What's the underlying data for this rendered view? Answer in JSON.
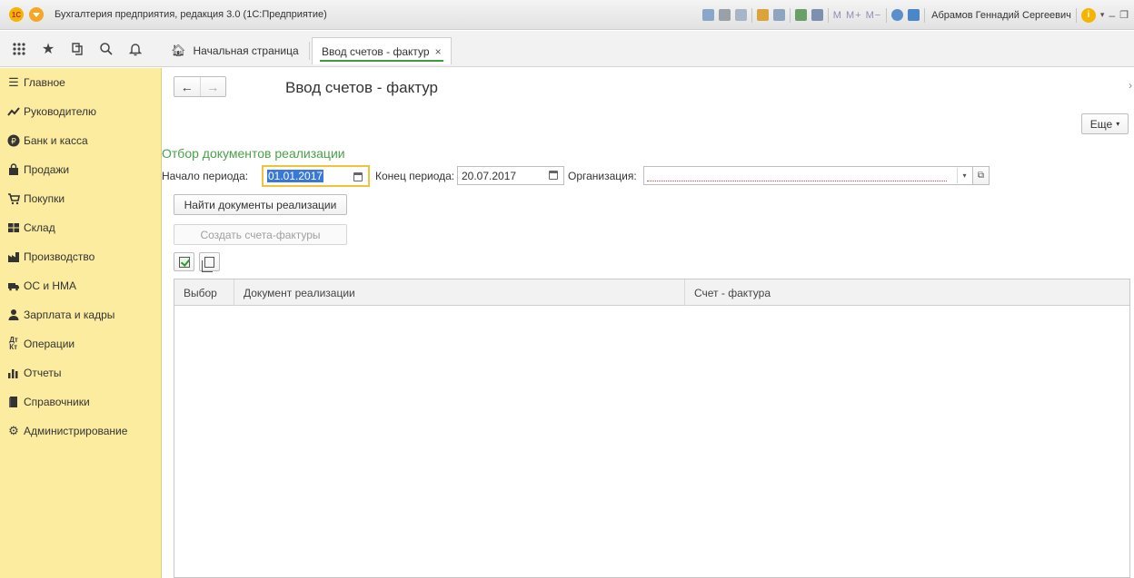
{
  "titlebar": {
    "logo_text": "1С",
    "title": "Бухгалтерия предприятия, редакция 3.0  (1С:Предприятие)",
    "memory_buttons": "M  M+  M−",
    "user": "Абрамов Геннадий Сергеевич",
    "info": "i"
  },
  "tabs": {
    "home": "Начальная страница",
    "active": "Ввод счетов - фактур",
    "close": "×"
  },
  "sidebar": {
    "items": [
      {
        "label": "Главное",
        "icon": "menu-icon"
      },
      {
        "label": "Руководителю",
        "icon": "chart-line-icon"
      },
      {
        "label": "Банк и касса",
        "icon": "ruble-coin-icon"
      },
      {
        "label": "Продажи",
        "icon": "shopping-bag-icon"
      },
      {
        "label": "Покупки",
        "icon": "cart-icon"
      },
      {
        "label": "Склад",
        "icon": "warehouse-icon"
      },
      {
        "label": "Производство",
        "icon": "factory-icon"
      },
      {
        "label": "ОС и НМА",
        "icon": "truck-icon"
      },
      {
        "label": "Зарплата и кадры",
        "icon": "person-icon"
      },
      {
        "label": "Операции",
        "icon": "dt-kt-icon"
      },
      {
        "label": "Отчеты",
        "icon": "bar-chart-icon"
      },
      {
        "label": "Справочники",
        "icon": "book-icon"
      },
      {
        "label": "Администрирование",
        "icon": "gear-icon"
      }
    ]
  },
  "main": {
    "back": "←",
    "forward": "→",
    "title": "Ввод счетов - фактур",
    "more_button": "Еще",
    "filter_title": "Отбор документов реализации",
    "period_start_label": "Начало периода:",
    "period_start_value": "01.01.2017",
    "period_end_label": "Конец периода:",
    "period_end_value": "20.07.2017",
    "org_label": "Организация:",
    "org_value": "",
    "find_button": "Найти документы реализации",
    "create_button": "Создать счета-фактуры"
  },
  "table": {
    "columns": [
      "Выбор",
      "Документ реализации",
      "Счет - фактура"
    ],
    "rows": []
  },
  "colors": {
    "sidebar_bg": "#fbeca0",
    "accent_green": "#4aa14a",
    "focus_yellow": "#f0c43a",
    "selection_blue": "#3a78d8"
  }
}
